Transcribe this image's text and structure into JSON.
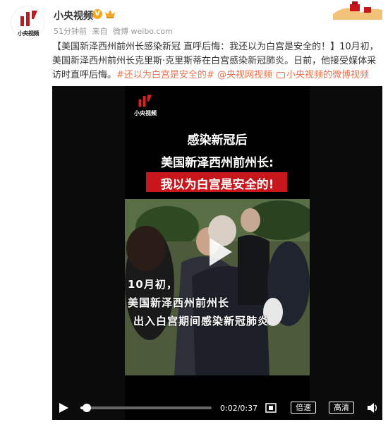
{
  "header": {
    "avatar_text": "小央视频",
    "user_name": "小央视频",
    "verified_badge": "V",
    "meta": {
      "time": "51分钟前",
      "source_prefix": "来自",
      "source": "微博 weibo.com"
    }
  },
  "post": {
    "title_text": "【美国新泽西州前州长感染新冠 直呼后悔：我还以为白宫是安全的！】",
    "body_text": "10月初，美国新泽西州前州长克里斯·克里斯蒂在白宫感染新冠肺炎。日前，他接受媒体采访时直呼后悔。",
    "hashtag": "#还以为白宫是安全的#",
    "mention": "@央视网视频",
    "link_text": "小央视频的微博视频"
  },
  "video": {
    "frame_logo_text": "小央视频",
    "headline_line1": "感染新冠后",
    "headline_line2": "美国新泽西州前州长:",
    "headline_line3": "我以为白宫是安全的!",
    "subtitle_line1": "10月初，",
    "subtitle_line2": "美国新泽西州前州长",
    "subtitle_line3": "出入白宫期间感染新冠肺炎",
    "progress_fraction": 0.05,
    "time": "0:02/0:37",
    "speed_label": "倍速",
    "quality_label": "高清"
  },
  "colors": {
    "accent": "#eb7350",
    "brand_red": "#c8161d",
    "verified": "#f5a623"
  },
  "icons": [
    "avatar-logo",
    "verified-icon",
    "crown-icon",
    "link-icon",
    "play-overlay-icon",
    "play-icon",
    "fullscreen-icon",
    "volume-icon"
  ]
}
